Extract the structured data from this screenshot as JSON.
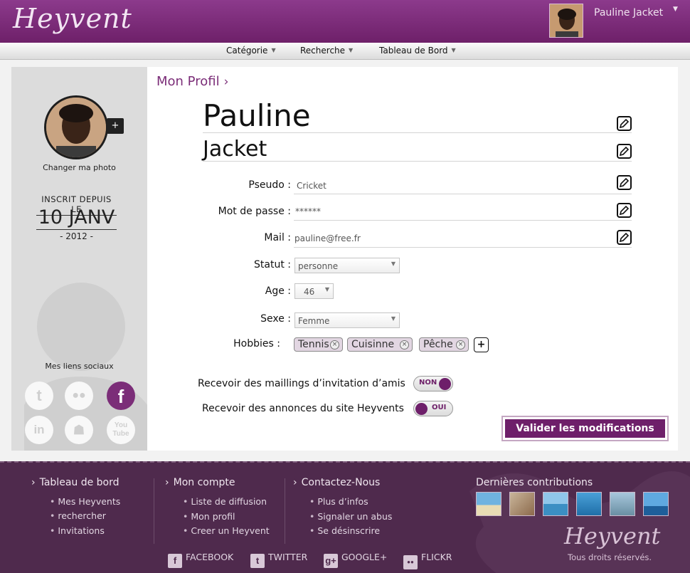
{
  "header": {
    "logo": "Heyvent",
    "user_name": "Pauline Jacket"
  },
  "nav": {
    "items": [
      {
        "label": "Catégorie"
      },
      {
        "label": "Recherche"
      },
      {
        "label": "Tableau de Bord"
      }
    ]
  },
  "sidebar": {
    "change_photo": "Changer ma photo",
    "since_label": "INSCRIT DEPUIS LE",
    "since_date": "10 JANV",
    "since_year": "- 2012 -",
    "social_title": "Mes liens sociaux",
    "socials": [
      {
        "name": "twitter-icon",
        "glyph": "t"
      },
      {
        "name": "flickr-icon",
        "glyph": "●●"
      },
      {
        "name": "facebook-icon",
        "glyph": "f",
        "active": true
      },
      {
        "name": "linkedin-icon",
        "glyph": "in"
      },
      {
        "name": "myspace-icon",
        "glyph": "☗"
      },
      {
        "name": "youtube-icon",
        "glyph": "You Tube"
      }
    ]
  },
  "profile": {
    "breadcrumb": "Mon Profil",
    "first_name": "Pauline",
    "last_name": "Jacket",
    "pseudo_label": "Pseudo :",
    "pseudo": "Cricket",
    "password_label": "Mot de passe :",
    "password": "******",
    "mail_label": "Mail :",
    "mail": "pauline@free.fr",
    "statut_label": "Statut :",
    "statut": "personne",
    "age_label": "Age :",
    "age": "46",
    "sexe_label": "Sexe :",
    "sexe": "Femme",
    "hobbies_label": "Hobbies :",
    "hobbies": [
      "Tennis",
      "Cuisinne",
      "Pêche"
    ]
  },
  "preferences": {
    "invites_label": "Recevoir des maillings d’invitation d’amis",
    "invites_state": "NON",
    "announces_label": "Recevoir des annonces du site Heyvents",
    "announces_state": "OUI"
  },
  "actions": {
    "submit": "Valider les modifications"
  },
  "footer": {
    "col1": {
      "title": "Tableau de bord",
      "links": [
        "Mes Heyvents",
        "rechercher",
        "Invitations"
      ]
    },
    "col2": {
      "title": "Mon compte",
      "links": [
        "Liste de diffusion",
        "Mon profil",
        "Creer un Heyvent"
      ]
    },
    "col3": {
      "title": "Contactez-Nous",
      "links": [
        "Plus d’infos",
        "Signaler un abus",
        "Se désinscrire"
      ]
    },
    "contrib_title": "Dernières contributions",
    "logo": "Heyvent",
    "rights": "Tous droits réservés.",
    "social": [
      {
        "label": "FACEBOOK",
        "glyph": "f"
      },
      {
        "label": "TWITTER",
        "glyph": "t"
      },
      {
        "label": "GOOGLE+",
        "glyph": "g+"
      },
      {
        "label": "FLICKR",
        "glyph": "●●"
      }
    ]
  },
  "colors": {
    "brand_purple": "#6e2069",
    "footer_bg": "#4f2a4d",
    "tag_bg": "#e2d6e2"
  }
}
